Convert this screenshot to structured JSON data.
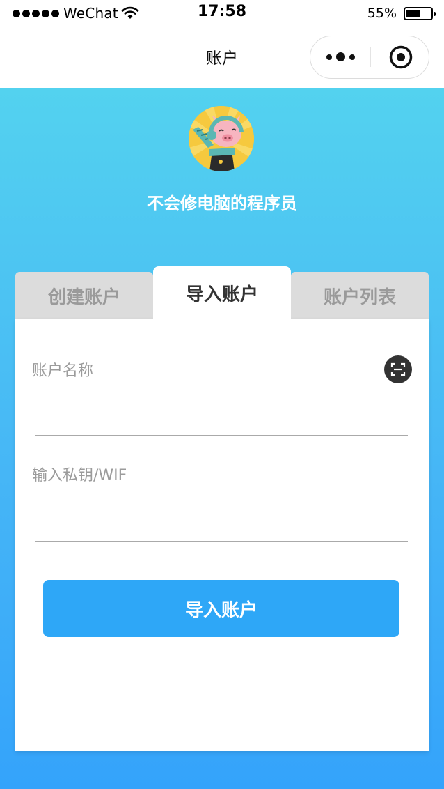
{
  "status_bar": {
    "carrier": "WeChat",
    "time": "17:58",
    "battery_percent": "55%",
    "battery_level": 0.55
  },
  "nav": {
    "title": "账户"
  },
  "profile": {
    "username": "不会修电脑的程序员"
  },
  "tabs": [
    {
      "label": "创建账户",
      "active": false
    },
    {
      "label": "导入账户",
      "active": true
    },
    {
      "label": "账户列表",
      "active": false
    }
  ],
  "form": {
    "account_name_label": "账户名称",
    "account_name_value": "",
    "private_key_label": "输入私钥/WIF",
    "private_key_value": "",
    "submit_label": "导入账户"
  },
  "colors": {
    "gradient_top": "#53d2ef",
    "gradient_bottom": "#34a3fb",
    "primary_button": "#2ea7f7",
    "inactive_tab": "#dcdcdc"
  },
  "icons": {
    "signal": "signal-dots-icon",
    "wifi": "wifi-icon",
    "battery": "battery-icon",
    "more": "more-dots-icon",
    "close": "target-close-icon",
    "scan": "scan-icon"
  }
}
